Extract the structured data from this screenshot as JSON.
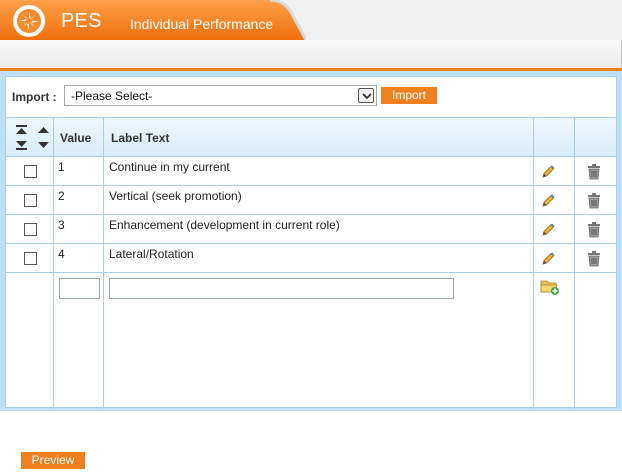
{
  "header": {
    "title": "PES",
    "subtitle": "Individual Performance"
  },
  "import": {
    "label": "Import :",
    "select_value": "-Please Select-",
    "button_label": "Import"
  },
  "table": {
    "columns": {
      "value": "Value",
      "label": "Label Text"
    },
    "rows": [
      {
        "value": "1",
        "label": "Continue in my current"
      },
      {
        "value": "2",
        "label": "Vertical (seek promotion)"
      },
      {
        "value": "3",
        "label": "Enhancement (development in current role)"
      },
      {
        "value": "4",
        "label": "Lateral/Rotation"
      }
    ],
    "new_row": {
      "value": "",
      "label": ""
    }
  },
  "footer": {
    "preview_label": "Preview"
  },
  "colors": {
    "accent": "#f07f1e",
    "panel_border": "#bfe0f4",
    "grid_line": "#a9cfe8"
  },
  "icons": {
    "sort": [
      "move-top-icon",
      "move-up-icon",
      "move-bottom-icon",
      "move-down-icon"
    ],
    "edit": "pencil-icon",
    "delete": "trash-icon",
    "add": "add-folder-icon",
    "logo": "pes-logo-icon"
  }
}
